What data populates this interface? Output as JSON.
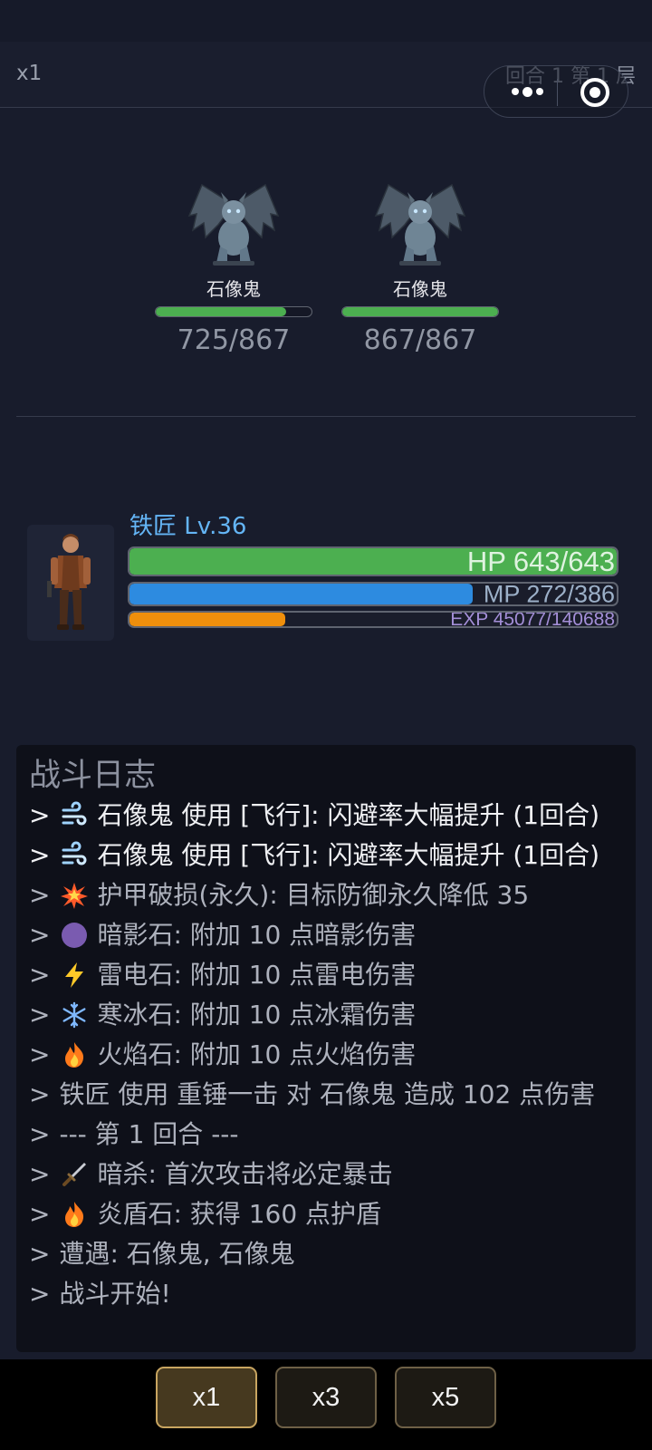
{
  "topbar": {
    "speed": "x1",
    "round_info": "回合 1  第 1 层"
  },
  "enemies": [
    {
      "name": "石像鬼",
      "hp_text": "725/867",
      "hp_fraction": 0.836
    },
    {
      "name": "石像鬼",
      "hp_text": "867/867",
      "hp_fraction": 1.0
    }
  ],
  "player": {
    "name": "铁匠  Lv.36",
    "hp_text": "HP 643/643",
    "hp_fraction": 1.0,
    "mp_text": "MP 272/386",
    "mp_fraction": 0.705,
    "exp_text": "EXP 45077/140688",
    "exp_fraction": 0.32
  },
  "log": {
    "title": "战斗日志",
    "lines": [
      {
        "icon": "wind-icon",
        "text": "石像鬼 使用 [飞行]: 闪避率大幅提升 (1回合)",
        "bright": true
      },
      {
        "icon": "wind-icon",
        "text": "石像鬼 使用 [飞行]: 闪避率大幅提升 (1回合)",
        "bright": true
      },
      {
        "icon": "explosion-icon",
        "text": "护甲破损(永久): 目标防御永久降低 35",
        "bright": false
      },
      {
        "icon": "purple-circle-icon",
        "text": "暗影石: 附加 10 点暗影伤害",
        "bright": false
      },
      {
        "icon": "lightning-icon",
        "text": "雷电石: 附加 10 点雷电伤害",
        "bright": false
      },
      {
        "icon": "snowflake-icon",
        "text": "寒冰石: 附加 10 点冰霜伤害",
        "bright": false
      },
      {
        "icon": "fire-icon",
        "text": "火焰石: 附加 10 点火焰伤害",
        "bright": false
      },
      {
        "icon": "",
        "text": "铁匠 使用 重锤一击 对 石像鬼 造成 102 点伤害",
        "bright": false
      },
      {
        "icon": "",
        "text": "--- 第 1 回合 ---",
        "bright": false
      },
      {
        "icon": "dagger-icon",
        "text": "暗杀: 首次攻击将必定暴击",
        "bright": false
      },
      {
        "icon": "fire-icon",
        "text": "炎盾石: 获得 160 点护盾",
        "bright": false
      },
      {
        "icon": "",
        "text": "遭遇: 石像鬼, 石像鬼",
        "bright": false
      },
      {
        "icon": "",
        "text": "战斗开始!",
        "bright": false
      }
    ]
  },
  "controls": {
    "speeds": [
      {
        "label": "x1",
        "active": true
      },
      {
        "label": "x3",
        "active": false
      },
      {
        "label": "x5",
        "active": false
      }
    ]
  },
  "colors": {
    "hp": "#4caf50",
    "mp": "#2d8be0",
    "exp": "#ef8f0c",
    "player_name": "#64b5f6"
  }
}
